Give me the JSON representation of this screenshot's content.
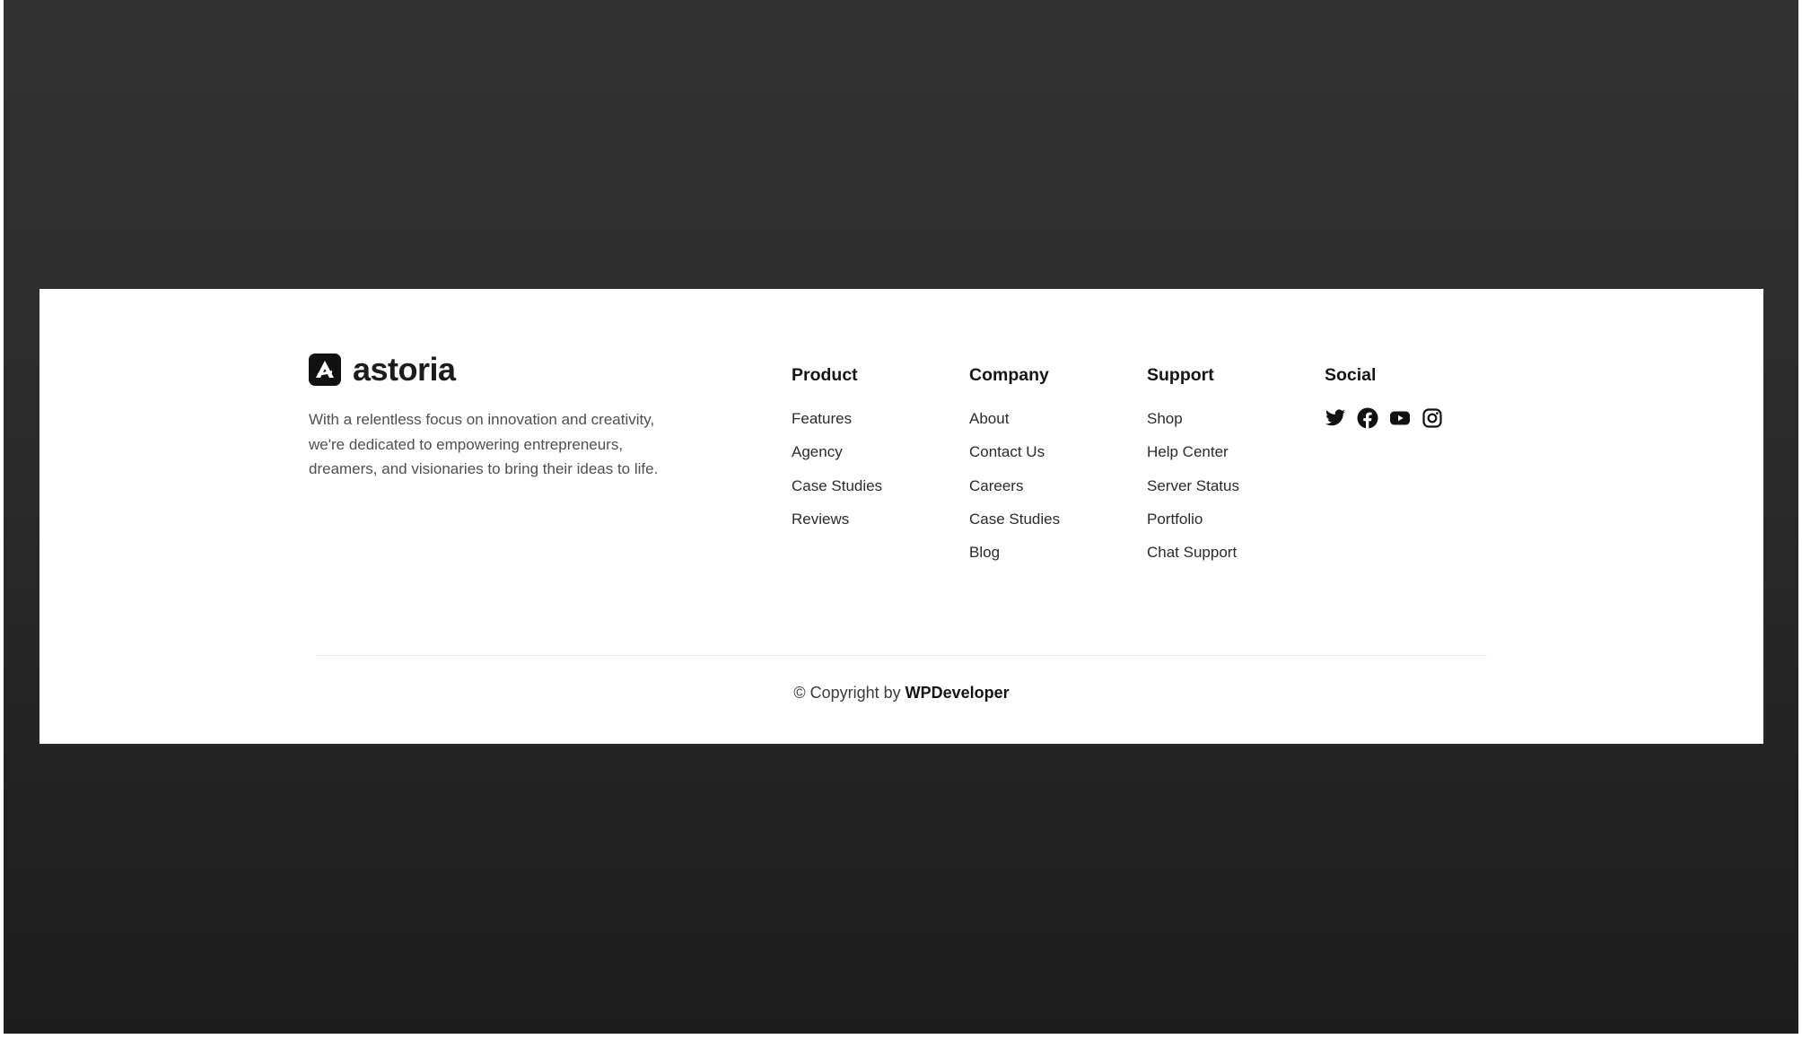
{
  "brand": {
    "name": "astoria",
    "tagline": "With a relentless focus on innovation and creativity, we're dedicated to empowering entrepreneurs, dreamers, and visionaries to bring their ideas to life."
  },
  "columns": {
    "product": {
      "title": "Product",
      "links": [
        "Features",
        "Agency",
        "Case Studies",
        "Reviews"
      ]
    },
    "company": {
      "title": "Company",
      "links": [
        "About",
        "Contact Us",
        "Careers",
        "Case Studies",
        "Blog"
      ]
    },
    "support": {
      "title": "Support",
      "links": [
        "Shop",
        "Help Center",
        "Server Status",
        "Portfolio",
        "Chat Support"
      ]
    },
    "social": {
      "title": "Social",
      "icons": [
        "twitter-icon",
        "facebook-icon",
        "youtube-icon",
        "instagram-icon"
      ]
    }
  },
  "footer": {
    "copyright_prefix": "© Copyright by ",
    "copyright_owner": "WPDeveloper"
  },
  "colors": {
    "backdrop": "#2c2c2c",
    "card": "#ffffff",
    "text_dark": "#151515",
    "text_muted": "#4f4f4f",
    "divider": "#e6e6e6"
  }
}
